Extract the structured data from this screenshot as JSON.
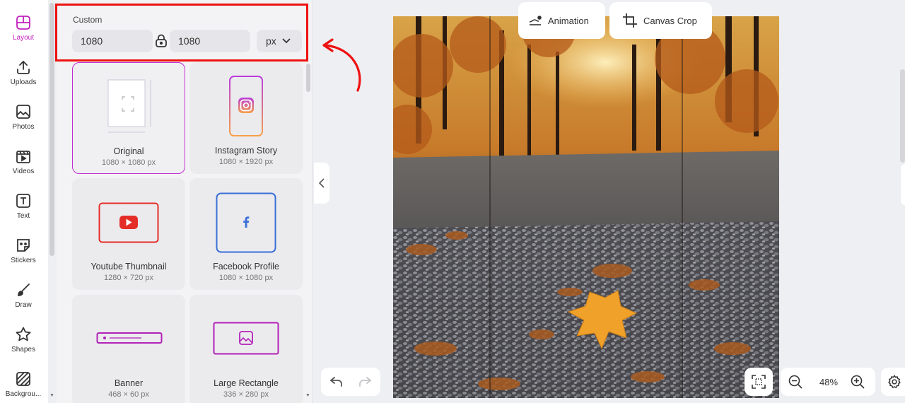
{
  "sidebar": {
    "items": [
      {
        "label": "Layout",
        "icon": "layout-icon",
        "active": true
      },
      {
        "label": "Uploads",
        "icon": "upload-icon"
      },
      {
        "label": "Photos",
        "icon": "image-icon"
      },
      {
        "label": "Videos",
        "icon": "video-icon"
      },
      {
        "label": "Text",
        "icon": "text-icon"
      },
      {
        "label": "Stickers",
        "icon": "sticker-icon"
      },
      {
        "label": "Draw",
        "icon": "brush-icon"
      },
      {
        "label": "Shapes",
        "icon": "star-icon"
      },
      {
        "label": "Backgrou...",
        "icon": "background-icon"
      }
    ]
  },
  "panel": {
    "custom_label": "Custom",
    "width_value": "1080",
    "height_value": "1080",
    "unit": "px",
    "presets": [
      {
        "title": "Original",
        "size": "1080 × 1080 px",
        "selected": true
      },
      {
        "title": "Instagram Story",
        "size": "1080 × 1920 px"
      },
      {
        "title": "Youtube Thumbnail",
        "size": "1280 × 720 px"
      },
      {
        "title": "Facebook Profile",
        "size": "1080 × 1080 px"
      },
      {
        "title": "Banner",
        "size": "468 × 60 px"
      },
      {
        "title": "Large Rectangle",
        "size": "336 × 280 px"
      }
    ]
  },
  "toolbar": {
    "animation_label": "Animation",
    "canvas_crop_label": "Canvas Crop"
  },
  "zoom": {
    "level": "48%"
  },
  "colors": {
    "accent": "#c21fbf",
    "highlight": "#ee1111",
    "youtube": "#e52d27",
    "facebook": "#3b6fd6"
  }
}
